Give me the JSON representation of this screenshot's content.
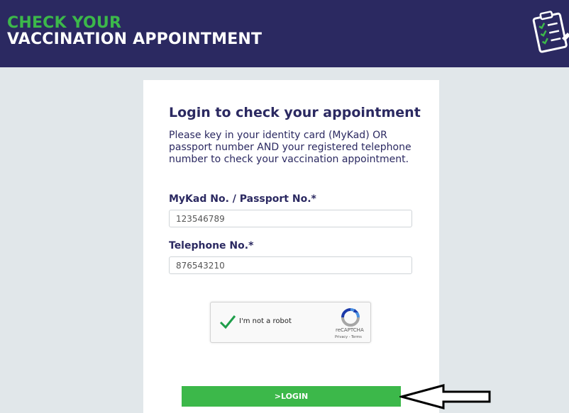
{
  "header": {
    "title_line1": "CHECK YOUR",
    "title_line2": "VACCINATION APPOINTMENT",
    "icon": "clipboard-checklist-icon"
  },
  "form": {
    "title": "Login to check your appointment",
    "description": "Please key in your identity card (MyKad) OR passport number AND your registered telephone number to check your vaccination appointment.",
    "mykad_label": "MyKad No. / Passport No.*",
    "mykad_value": "123546789",
    "phone_label": "Telephone No.*",
    "phone_value": "876543210",
    "login_label": ">LOGIN"
  },
  "captcha": {
    "label": "I'm not a robot",
    "brand": "reCAPTCHA",
    "links": "Privacy - Terms",
    "checked": true
  },
  "colors": {
    "header_bg": "#2b2961",
    "accent_green": "#3cb84a",
    "page_bg": "#e1e7ea",
    "text_navy": "#2b2961"
  },
  "annotations": {
    "arrow_icon": "left-arrow-pointer-icon"
  }
}
